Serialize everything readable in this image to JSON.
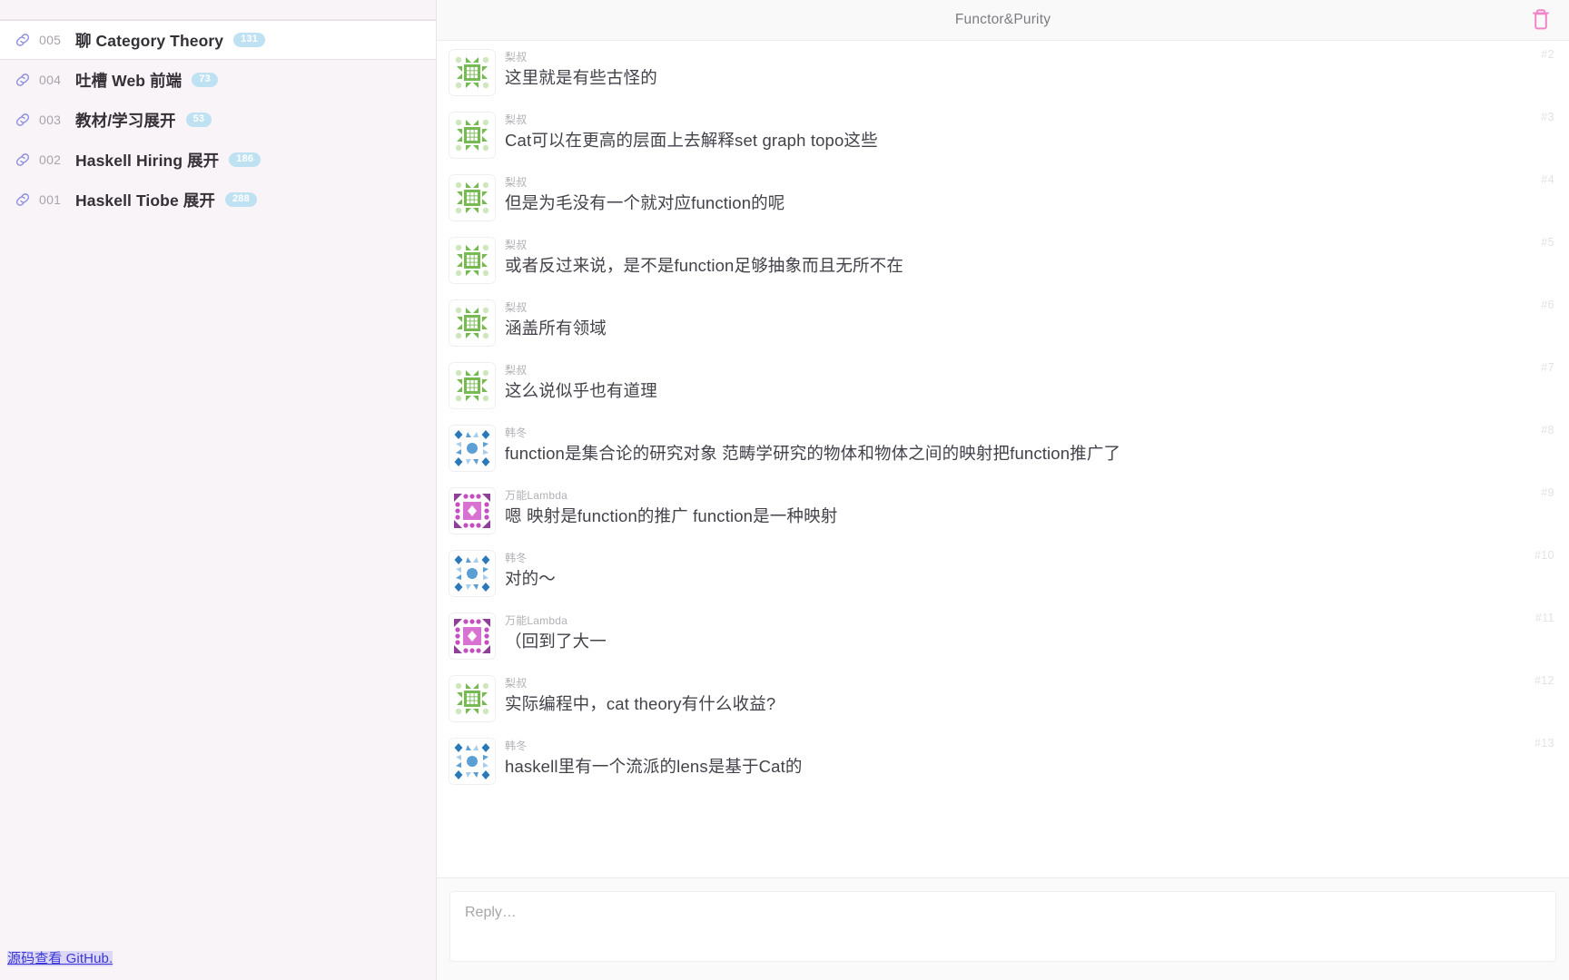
{
  "sidebar": {
    "threads": [
      {
        "icon": "link-icon",
        "number": "005",
        "title": "聊 Category Theory",
        "count": "131",
        "active": true
      },
      {
        "icon": "link-icon",
        "number": "004",
        "title": "吐槽 Web 前端",
        "count": "73",
        "active": false
      },
      {
        "icon": "link-icon",
        "number": "003",
        "title": "教材/学习展开",
        "count": "53",
        "active": false
      },
      {
        "icon": "link-icon",
        "number": "002",
        "title": "Haskell Hiring 展开",
        "count": "186",
        "active": false
      },
      {
        "icon": "link-icon",
        "number": "001",
        "title": "Haskell Tiobe 展开",
        "count": "288",
        "active": false
      }
    ],
    "footer": {
      "link_text": "源码查看 GitHub."
    }
  },
  "header": {
    "title": "Functor&Purity",
    "trash_icon": "trash-icon"
  },
  "messages": [
    {
      "index": "#2",
      "author": "梨叔",
      "avatar": "green",
      "text": "这里就是有些古怪的"
    },
    {
      "index": "#3",
      "author": "梨叔",
      "avatar": "green",
      "text": "Cat可以在更高的层面上去解释set graph topo这些"
    },
    {
      "index": "#4",
      "author": "梨叔",
      "avatar": "green",
      "text": "但是为毛没有一个就对应function的呢"
    },
    {
      "index": "#5",
      "author": "梨叔",
      "avatar": "green",
      "text": "或者反过来说，是不是function足够抽象而且无所不在"
    },
    {
      "index": "#6",
      "author": "梨叔",
      "avatar": "green",
      "text": "涵盖所有领域"
    },
    {
      "index": "#7",
      "author": "梨叔",
      "avatar": "green",
      "text": "这么说似乎也有道理"
    },
    {
      "index": "#8",
      "author": "韩冬",
      "avatar": "blue",
      "text": "function是集合论的研究对象 范畴学研究的物体和物体之间的映射把function推广了"
    },
    {
      "index": "#9",
      "author": "万能Lambda",
      "avatar": "purple",
      "text": "嗯 映射是function的推广 function是一种映射"
    },
    {
      "index": "#10",
      "author": "韩冬",
      "avatar": "blue",
      "text": "对的〜"
    },
    {
      "index": "#11",
      "author": "万能Lambda",
      "avatar": "purple",
      "text": "（回到了大一"
    },
    {
      "index": "#12",
      "author": "梨叔",
      "avatar": "green",
      "text": "实际编程中，cat theory有什么收益?"
    },
    {
      "index": "#13",
      "author": "韩冬",
      "avatar": "blue",
      "text": "haskell里有一个流派的lens是基于Cat的"
    }
  ],
  "reply": {
    "placeholder": "Reply…",
    "value": ""
  },
  "colors": {
    "sidebar_bg": "#f9f4f7",
    "badge_bg": "#bfe2f2",
    "trash": "#ef85c8",
    "link": "#3b37d8",
    "avatar_green": "#76bb52",
    "avatar_blue": "#2d79b8",
    "avatar_purple": "#c34fc0"
  }
}
